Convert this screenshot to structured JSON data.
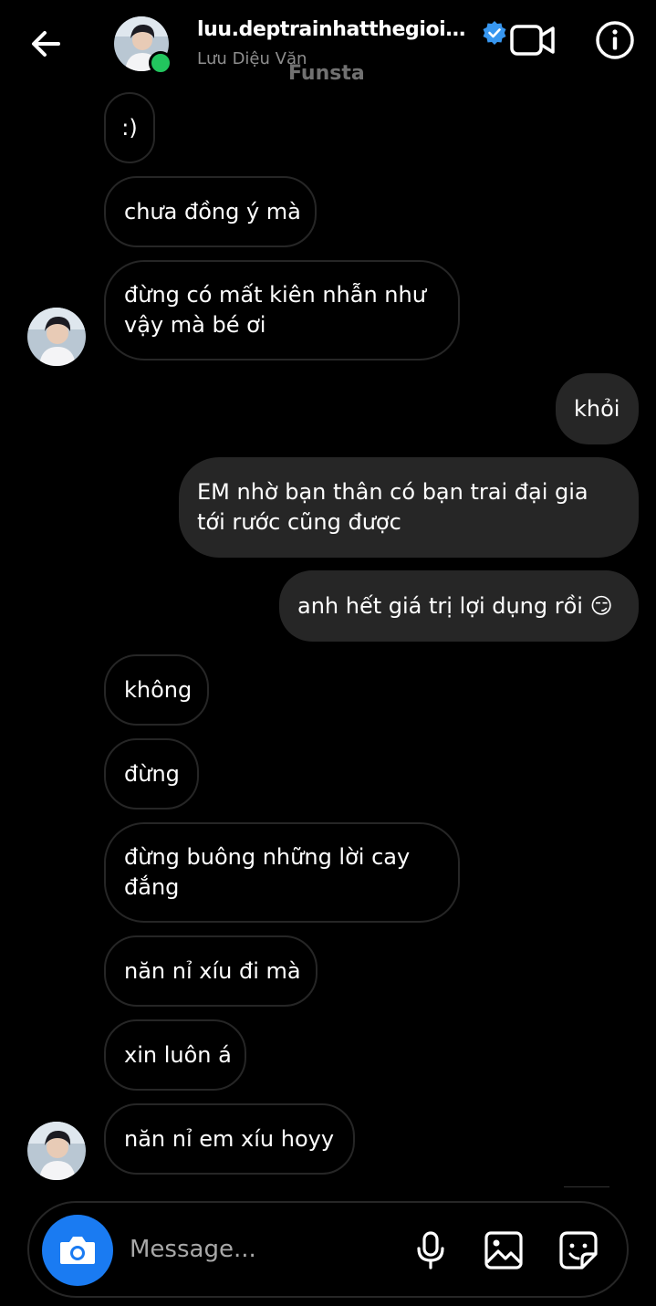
{
  "header": {
    "username": "luu.deptrainhatthegioi.dieu...",
    "display_name": "Lưu Diệu Văn",
    "watermark": "Funsta"
  },
  "messages": [
    {
      "side": "in",
      "text": ":)"
    },
    {
      "side": "in",
      "text": "chưa đồng ý mà"
    },
    {
      "side": "in",
      "text": "đừng có mất kiên nhẫn như vậy mà bé ơi"
    },
    {
      "side": "out",
      "text": "khỏi"
    },
    {
      "side": "out",
      "text": "EM nhờ bạn thân có bạn trai đại gia tới rước cũng được"
    },
    {
      "side": "out",
      "text": "anh hết giá trị lợi dụng rồi 😏"
    },
    {
      "side": "in",
      "text": "không"
    },
    {
      "side": "in",
      "text": "đừng"
    },
    {
      "side": "in",
      "text": "đừng buông những lời cay đắng"
    },
    {
      "side": "in",
      "text": "năn nỉ xíu đi mà"
    },
    {
      "side": "in",
      "text": "xin luôn á"
    },
    {
      "side": "in",
      "text": "năn nỉ em xíu hoyy"
    }
  ],
  "composer": {
    "placeholder": "Message..."
  },
  "colors": {
    "background": "#000000",
    "outgoing_bubble": "#262626",
    "incoming_border": "#262626",
    "camera_button": "#1a7bf2",
    "verified_badge": "#3897f0",
    "online_dot": "#22c55e"
  },
  "icons": [
    "back-arrow-icon",
    "verified-badge-icon",
    "video-call-icon",
    "info-icon",
    "camera-icon",
    "microphone-icon",
    "gallery-icon",
    "sticker-icon"
  ]
}
